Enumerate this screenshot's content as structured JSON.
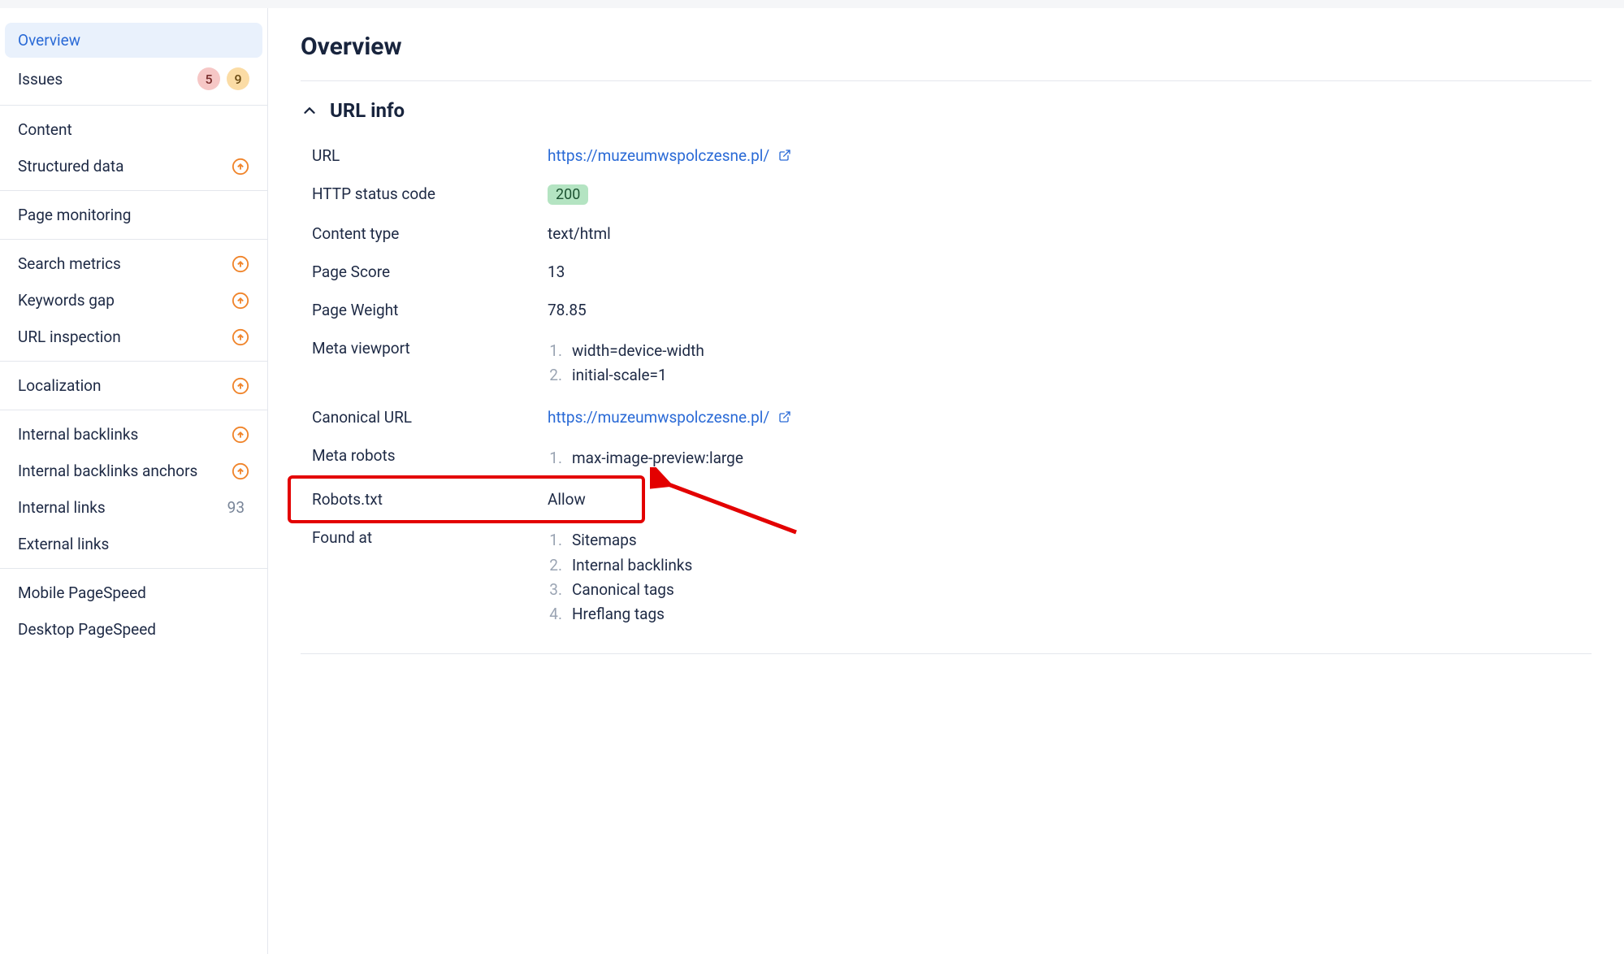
{
  "sidebar": {
    "groups": [
      {
        "items": [
          {
            "label": "Overview",
            "active": true
          },
          {
            "label": "Issues",
            "badges": [
              5,
              9
            ]
          }
        ]
      },
      {
        "items": [
          {
            "label": "Content"
          },
          {
            "label": "Structured data",
            "upgrade": true
          }
        ]
      },
      {
        "items": [
          {
            "label": "Page monitoring"
          }
        ]
      },
      {
        "items": [
          {
            "label": "Search metrics",
            "upgrade": true
          },
          {
            "label": "Keywords gap",
            "upgrade": true
          },
          {
            "label": "URL inspection",
            "upgrade": true
          }
        ]
      },
      {
        "items": [
          {
            "label": "Localization",
            "upgrade": true
          }
        ]
      },
      {
        "items": [
          {
            "label": "Internal backlinks",
            "upgrade": true
          },
          {
            "label": "Internal backlinks anchors",
            "upgrade": true
          },
          {
            "label": "Internal links",
            "count": 93
          },
          {
            "label": "External links"
          }
        ]
      },
      {
        "items": [
          {
            "label": "Mobile PageSpeed"
          },
          {
            "label": "Desktop PageSpeed"
          }
        ]
      }
    ]
  },
  "main": {
    "title": "Overview",
    "section_title": "URL info",
    "rows": {
      "url_label": "URL",
      "url_value": "https://muzeumwspolczesne.pl/",
      "http_label": "HTTP status code",
      "http_value": "200",
      "ctype_label": "Content type",
      "ctype_value": "text/html",
      "pscore_label": "Page Score",
      "pscore_value": "13",
      "pweight_label": "Page Weight",
      "pweight_value": "78.85",
      "viewport_label": "Meta viewport",
      "viewport_values": [
        "width=device-width",
        "initial-scale=1"
      ],
      "canonical_label": "Canonical URL",
      "canonical_value": "https://muzeumwspolczesne.pl/",
      "mrobots_label": "Meta robots",
      "mrobots_values": [
        "max-image-preview:large"
      ],
      "robots_label": "Robots.txt",
      "robots_value": "Allow",
      "found_label": "Found at",
      "found_values": [
        "Sitemaps",
        "Internal backlinks",
        "Canonical tags",
        "Hreflang tags"
      ]
    }
  }
}
